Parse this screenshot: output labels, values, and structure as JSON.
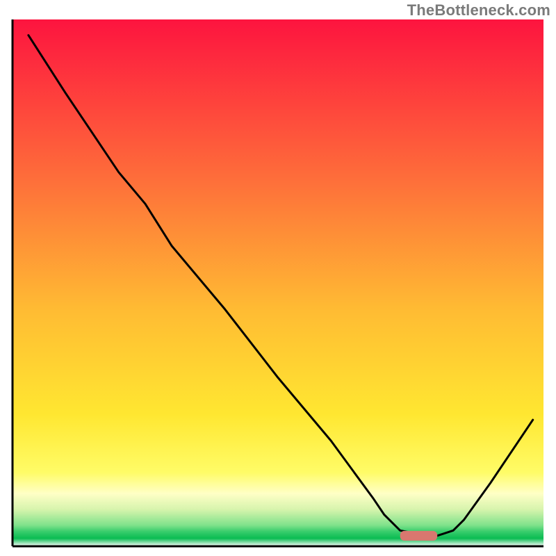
{
  "watermark": "TheBottleneck.com",
  "chart_data": {
    "type": "line",
    "title": "",
    "xlabel": "",
    "ylabel": "",
    "xlim": [
      0,
      100
    ],
    "ylim": [
      0,
      100
    ],
    "grid": false,
    "legend": false,
    "x": [
      3,
      10,
      20,
      25,
      30,
      40,
      50,
      60,
      68,
      70,
      73,
      78,
      80,
      83,
      85,
      90,
      98
    ],
    "values": [
      97,
      86,
      71,
      65,
      57,
      45,
      32,
      20,
      9,
      6,
      3,
      2,
      2,
      3,
      5,
      12,
      24
    ],
    "marker": {
      "x_range": [
        73,
        80
      ],
      "y": 2,
      "color": "#d9776f"
    },
    "gradient_bands": [
      {
        "stop": 0.0,
        "color": "#fd143f"
      },
      {
        "stop": 0.3,
        "color": "#fe6d3a"
      },
      {
        "stop": 0.55,
        "color": "#ffbb33"
      },
      {
        "stop": 0.75,
        "color": "#ffe731"
      },
      {
        "stop": 0.86,
        "color": "#fffc67"
      },
      {
        "stop": 0.9,
        "color": "#ffffc6"
      },
      {
        "stop": 0.93,
        "color": "#d7f4ad"
      },
      {
        "stop": 0.96,
        "color": "#7fe28b"
      },
      {
        "stop": 0.972,
        "color": "#39cd6c"
      },
      {
        "stop": 0.985,
        "color": "#0abc52"
      },
      {
        "stop": 1.0,
        "color": "#ffffff"
      }
    ]
  }
}
